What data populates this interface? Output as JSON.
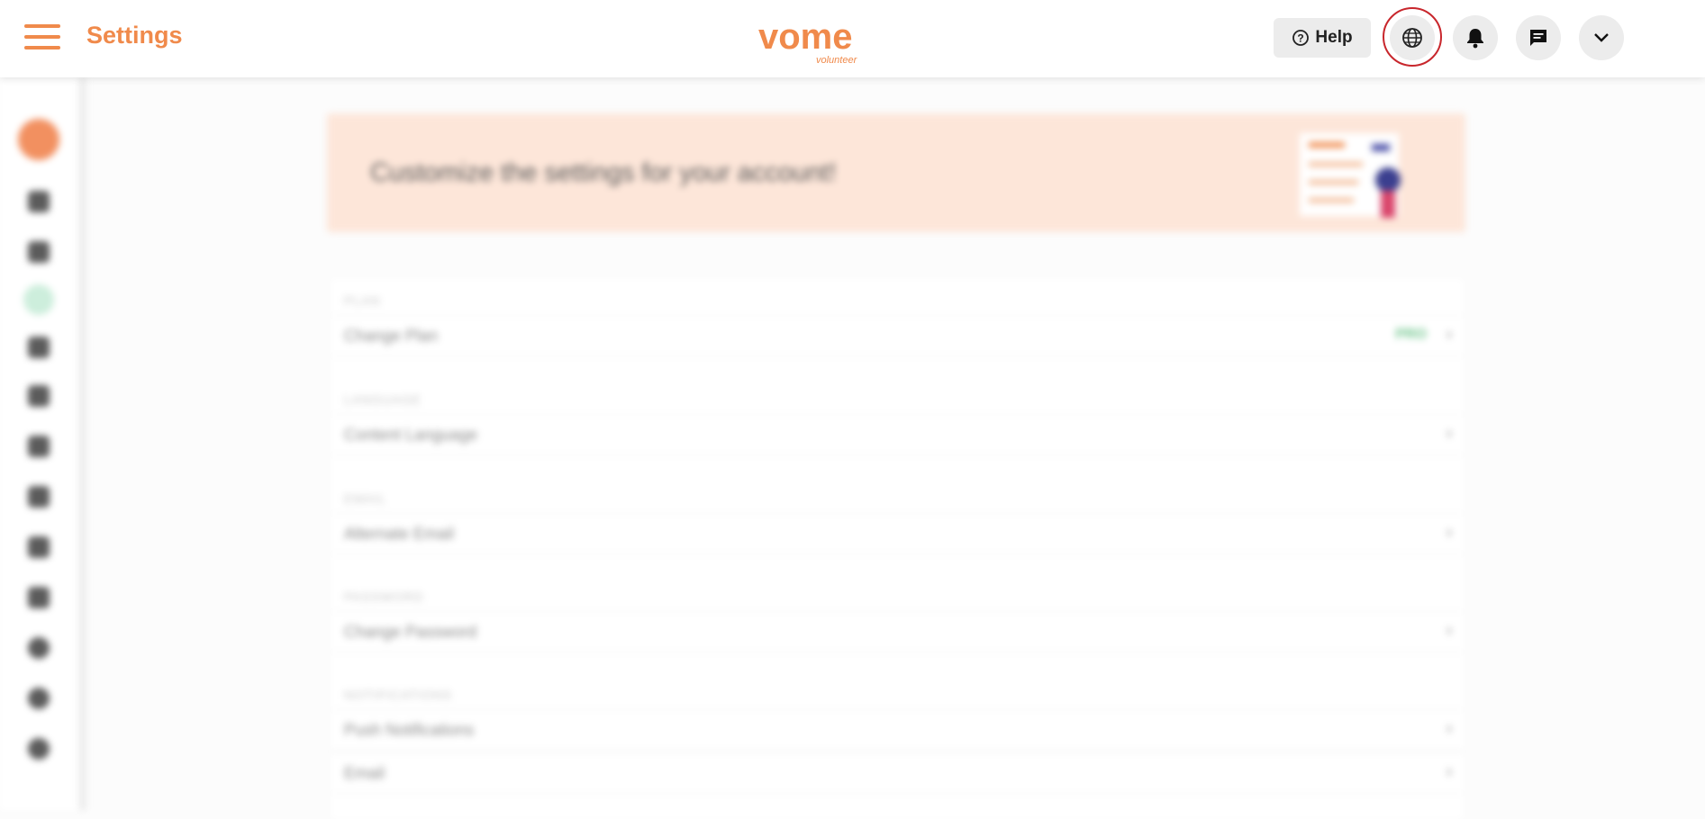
{
  "header": {
    "title": "Settings",
    "logo_text": "vome",
    "logo_sub": "volunteer",
    "help_label": "Help"
  },
  "banner": {
    "text": "Customize the settings for your account!"
  },
  "settings": {
    "sections": [
      {
        "heading": "PLAN",
        "rows": [
          {
            "label": "Change Plan",
            "badge": "PRO"
          }
        ]
      },
      {
        "heading": "LANGUAGE",
        "rows": [
          {
            "label": "Content Language"
          }
        ]
      },
      {
        "heading": "EMAIL",
        "rows": [
          {
            "label": "Alternate Email"
          }
        ]
      },
      {
        "heading": "PASSWORD",
        "rows": [
          {
            "label": "Change Password"
          }
        ]
      },
      {
        "heading": "NOTIFICATIONS",
        "rows": [
          {
            "label": "Push Notifications"
          },
          {
            "label": "Email"
          }
        ]
      }
    ]
  },
  "icons": {
    "menu": "menu-icon",
    "help": "help-circle-icon",
    "language": "globe-icon",
    "notifications": "bell-icon",
    "messages": "chat-icon",
    "profile_menu": "chevron-down-icon"
  },
  "colors": {
    "brand": "#f08a4b",
    "highlight_ring": "#c8262c",
    "pro_badge": "#6cc48a"
  }
}
